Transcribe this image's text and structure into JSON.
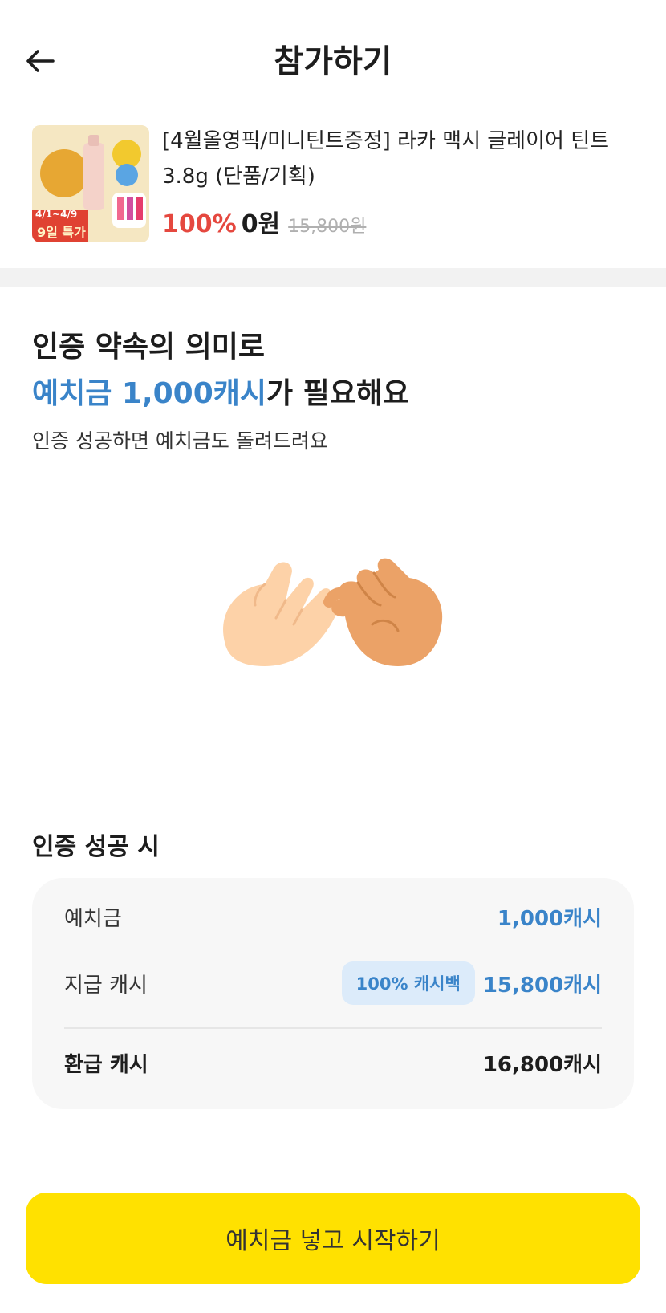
{
  "header": {
    "title": "참가하기"
  },
  "product": {
    "name": "[4월올영픽/미니틴트증정] 라카 맥시 글레이어 틴트 3.8g (단품/기획)",
    "discount": "100%",
    "price": "0원",
    "original_price": "15,800원",
    "thumbnail": {
      "promo_dates": "4/1~4/9",
      "promo_label": "9일 특가"
    }
  },
  "deposit": {
    "line1": "인증 약속의 의미로",
    "line2_accent": "예치금 1,000캐시",
    "line2_rest": "가 필요해요",
    "subtitle": "인증 성공하면 예치금도 돌려드려요"
  },
  "success": {
    "section_title": "인증 성공 시",
    "rows": [
      {
        "label": "예치금",
        "value": "1,000캐시"
      },
      {
        "label": "지급 캐시",
        "badge": "100% 캐시백",
        "value": "15,800캐시"
      },
      {
        "label": "환급 캐시",
        "value": "16,800캐시"
      }
    ]
  },
  "cta": {
    "label": "예치금 넣고 시작하기"
  },
  "colors": {
    "accent": "#3a84c9",
    "discount": "#e5483f",
    "cta": "#ffe100"
  },
  "icons": {
    "back": "arrow-left-icon",
    "illustration": "pinky-promise-hands-icon"
  }
}
